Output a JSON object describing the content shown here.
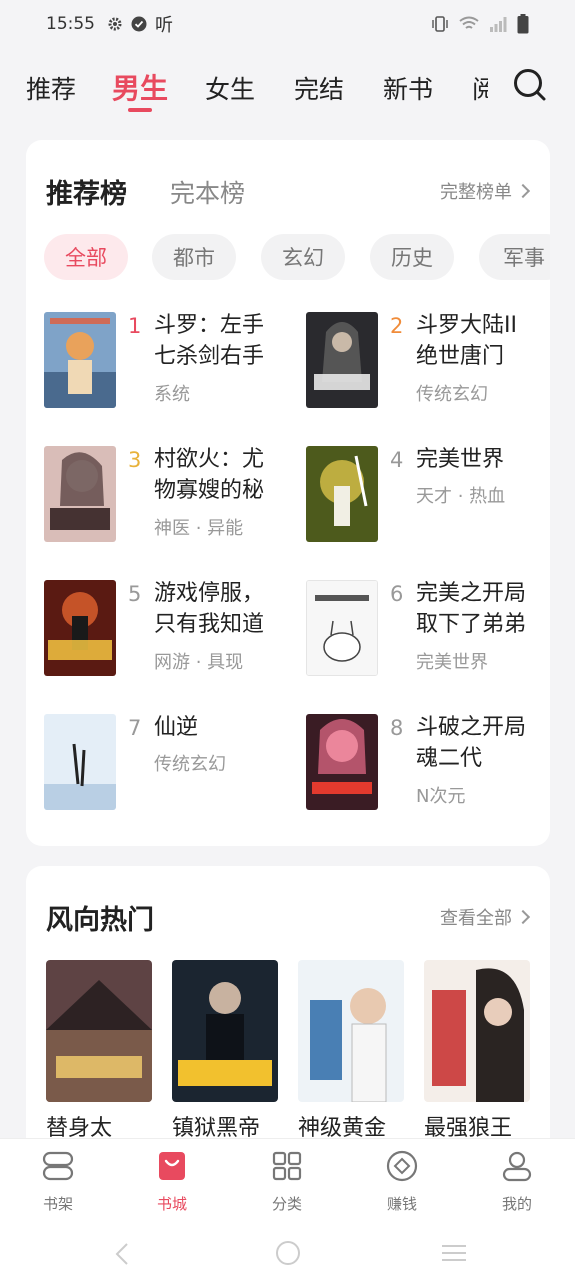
{
  "status_bar": {
    "time": "15:55",
    "listen_label": "听"
  },
  "top_nav": {
    "tabs": [
      {
        "label": "推荐",
        "active": false
      },
      {
        "label": "男生",
        "active": true
      },
      {
        "label": "女生",
        "active": false
      },
      {
        "label": "完结",
        "active": false
      },
      {
        "label": "新书",
        "active": false
      },
      {
        "label": "阅",
        "active": false
      }
    ]
  },
  "ranking": {
    "title": "推荐榜",
    "alt_title": "完本榜",
    "more_label": "完整榜单",
    "chips": [
      {
        "label": "全部",
        "active": true
      },
      {
        "label": "都市",
        "active": false
      },
      {
        "label": "玄幻",
        "active": false
      },
      {
        "label": "历史",
        "active": false
      },
      {
        "label": "军事",
        "active": false
      }
    ],
    "books": [
      {
        "rank": "1",
        "title": "斗罗：左手七杀剑右手",
        "tags": "系统",
        "cover_color": "#6b8fb6"
      },
      {
        "rank": "2",
        "title": "斗罗大陆II绝世唐门",
        "tags": "传统玄幻",
        "cover_color": "#2c2c30"
      },
      {
        "rank": "3",
        "title": "村欲火：尤物寡嫂的秘",
        "tags": "神医 · 异能",
        "cover_color": "#c9a7a2"
      },
      {
        "rank": "4",
        "title": "完美世界",
        "tags": "天才 · 热血",
        "cover_color": "#6c7a2a"
      },
      {
        "rank": "5",
        "title": "游戏停服，只有我知道",
        "tags": "网游 · 具现",
        "cover_color": "#7a2418"
      },
      {
        "rank": "6",
        "title": "完美之开局取下了弟弟",
        "tags": "完美世界",
        "cover_color": "#f2f2f2"
      },
      {
        "rank": "7",
        "title": "仙逆",
        "tags": "传统玄幻",
        "cover_color": "#dbe7f3"
      },
      {
        "rank": "8",
        "title": "斗破之开局魂二代",
        "tags": "N次元",
        "cover_color": "#3a1f26"
      }
    ]
  },
  "hot": {
    "title": "风向热门",
    "more_label": "查看全部",
    "books": [
      {
        "title": "替身太",
        "cover_color": "#6b4a48"
      },
      {
        "title": "镇狱黑帝",
        "cover_color": "#1c2430"
      },
      {
        "title": "神级黄金",
        "cover_color": "#eef3f6"
      },
      {
        "title": "最强狼王",
        "cover_color": "#f3ece8"
      }
    ]
  },
  "bottom_nav": {
    "items": [
      {
        "label": "书架",
        "active": false
      },
      {
        "label": "书城",
        "active": true
      },
      {
        "label": "分类",
        "active": false
      },
      {
        "label": "赚钱",
        "active": false
      },
      {
        "label": "我的",
        "active": false
      }
    ]
  },
  "colors": {
    "accent": "#e84a5f",
    "rank2": "#f08c3a",
    "rank3": "#e8b23a"
  }
}
